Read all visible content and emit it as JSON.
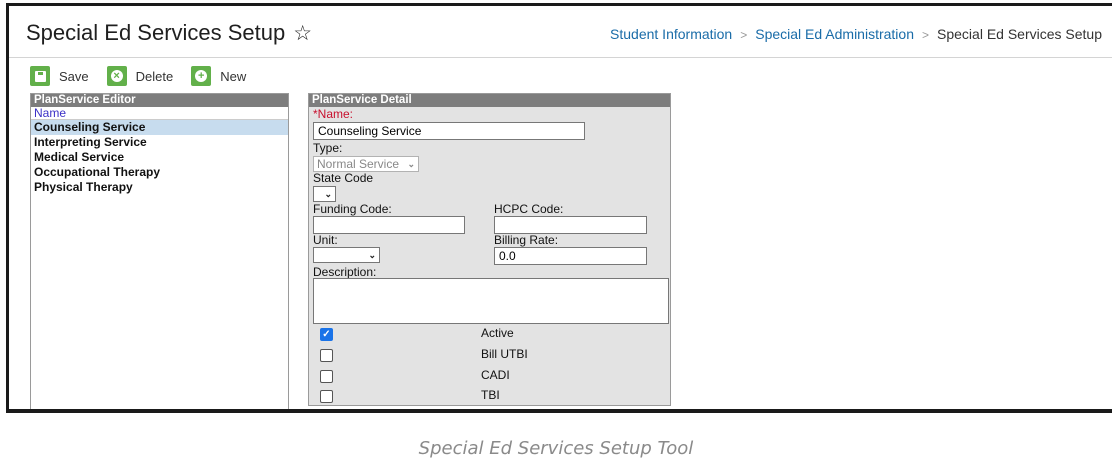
{
  "header": {
    "title": "Special Ed Services Setup",
    "favorite_icon": "star-outline-icon",
    "breadcrumb": [
      "Student Information",
      "Special Ed Administration",
      "Special Ed Services Setup"
    ]
  },
  "toolbar": {
    "save_label": "Save",
    "delete_label": "Delete",
    "new_label": "New"
  },
  "editor": {
    "title": "PlanService Editor",
    "column_header": "Name",
    "items": [
      "Counseling Service",
      "Interpreting Service",
      "Medical Service",
      "Occupational Therapy",
      "Physical Therapy"
    ],
    "selected_index": 0
  },
  "detail": {
    "title": "PlanService Detail",
    "name_required_marker": "*",
    "name_label": "Name:",
    "name_value": "Counseling Service",
    "type_label": "Type:",
    "type_value": "Normal Service",
    "state_code_label": "State Code",
    "state_code_value": "",
    "funding_code_label": "Funding Code:",
    "funding_code_value": "",
    "hcpc_code_label": "HCPC Code:",
    "hcpc_code_value": "",
    "unit_label": "Unit:",
    "unit_value": "",
    "billing_rate_label": "Billing Rate:",
    "billing_rate_value": "0.0",
    "description_label": "Description:",
    "description_value": "",
    "checkboxes": [
      {
        "label": "Active",
        "checked": true
      },
      {
        "label": "Bill UTBI",
        "checked": false
      },
      {
        "label": "CADI",
        "checked": false
      },
      {
        "label": "TBI",
        "checked": false
      }
    ]
  },
  "caption": "Special Ed Services Setup Tool",
  "colors": {
    "accent_green": "#62b04a",
    "link_blue": "#1a6ca8",
    "panel_header_gray": "#7d7d7d",
    "selected_row": "#c7dcee",
    "required_red": "#c8102e"
  }
}
